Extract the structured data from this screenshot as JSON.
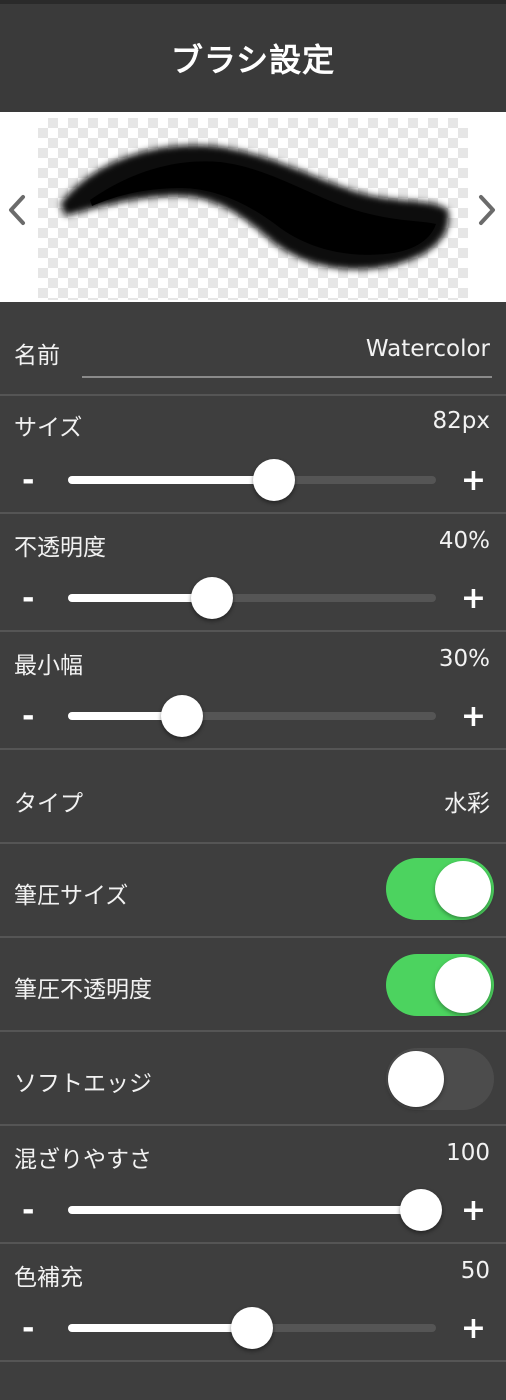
{
  "header": {
    "title": "ブラシ設定"
  },
  "preview": {
    "prev_icon": "chevron-left-icon",
    "next_icon": "chevron-right-icon"
  },
  "name": {
    "label": "名前",
    "value": "Watercolor"
  },
  "sliders": {
    "size": {
      "label": "サイズ",
      "value": "82px",
      "level": 0.56
    },
    "opacity": {
      "label": "不透明度",
      "value": "40%",
      "level": 0.39
    },
    "min_width": {
      "label": "最小幅",
      "value": "30%",
      "level": 0.31
    },
    "blend": {
      "label": "混ざりやすさ",
      "value": "100",
      "level": 0.96
    },
    "color_fill": {
      "label": "色補充",
      "value": "50",
      "level": 0.5
    }
  },
  "stepper": {
    "minus": "-",
    "plus": "+"
  },
  "type": {
    "label": "タイプ",
    "value": "水彩"
  },
  "toggles": {
    "pressure_size": {
      "label": "筆圧サイズ",
      "on": true
    },
    "pressure_opacity": {
      "label": "筆圧不透明度",
      "on": true
    },
    "soft_edge": {
      "label": "ソフトエッジ",
      "on": false
    }
  },
  "colors": {
    "background": "#3e3e3e",
    "toggle_on": "#4cd35f",
    "toggle_off": "#4c4c4c",
    "track": "#555555",
    "fill": "#ffffff"
  }
}
